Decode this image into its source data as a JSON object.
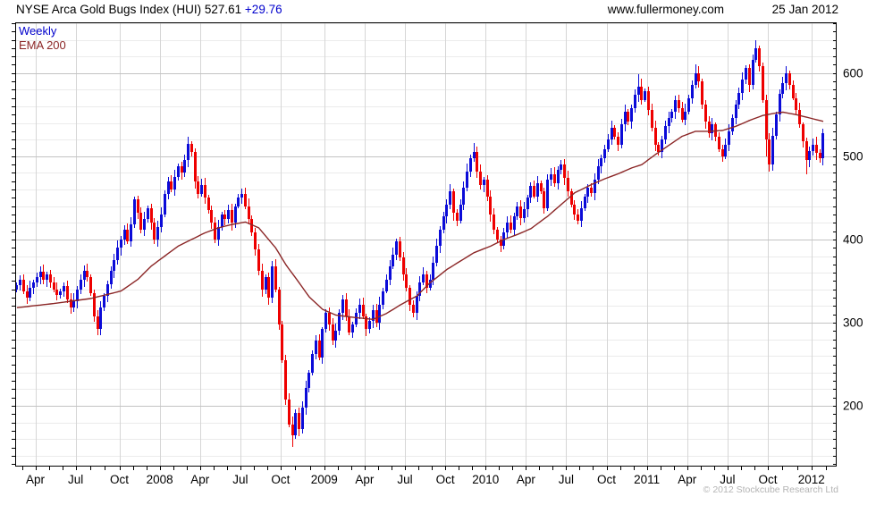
{
  "header": {
    "title": "NYSE Arca Gold Bugs Index (HUI)",
    "last_price": "527.61",
    "change": "+29.76",
    "url": "www.fullermoney.com",
    "date": "25 Jan 2012"
  },
  "legend": {
    "timeframe": "Weekly",
    "overlay": "EMA 200"
  },
  "footer": {
    "copyright": "© 2012 Stockcube Research Ltd"
  },
  "colors": {
    "up_candle": "#0b0bd8",
    "down_candle": "#ee0000",
    "ema_line": "#8b2626",
    "grid_major": "#c3c3c3",
    "grid_minor": "#ebebeb",
    "grid_vertical": "#d6d6d6",
    "axis": "#000000",
    "label_text": "#000000",
    "change_text": "#0000cc",
    "copyright_text": "#b4b4b4"
  },
  "chart_data": {
    "type": "candlestick",
    "title": "NYSE Arca Gold Bugs Index (HUI)",
    "timeframe": "Weekly",
    "last_close": 527.61,
    "weekly_change": 29.76,
    "first_open": 340,
    "closes": [
      345,
      352,
      338,
      330,
      342,
      348,
      355,
      361,
      352,
      358,
      348,
      340,
      333,
      338,
      344,
      328,
      318,
      326,
      340,
      352,
      362,
      355,
      335,
      308,
      292,
      318,
      332,
      346,
      362,
      375,
      390,
      400,
      412,
      398,
      418,
      448,
      432,
      412,
      425,
      438,
      420,
      400,
      415,
      430,
      455,
      470,
      460,
      475,
      488,
      480,
      495,
      515,
      505,
      470,
      455,
      465,
      450,
      435,
      420,
      400,
      415,
      430,
      425,
      435,
      420,
      440,
      450,
      455,
      440,
      425,
      408,
      388,
      362,
      340,
      355,
      330,
      368,
      340,
      298,
      255,
      208,
      178,
      165,
      192,
      172,
      198,
      222,
      240,
      262,
      278,
      258,
      292,
      312,
      298,
      278,
      290,
      312,
      328,
      308,
      288,
      298,
      312,
      322,
      308,
      292,
      302,
      315,
      300,
      322,
      338,
      352,
      368,
      382,
      398,
      378,
      358,
      342,
      322,
      312,
      332,
      348,
      358,
      342,
      352,
      372,
      392,
      412,
      428,
      442,
      458,
      432,
      422,
      442,
      462,
      482,
      498,
      505,
      482,
      465,
      472,
      452,
      430,
      412,
      400,
      392,
      408,
      420,
      412,
      428,
      440,
      426,
      436,
      450,
      464,
      452,
      468,
      458,
      438,
      472,
      478,
      468,
      484,
      490,
      474,
      458,
      442,
      430,
      422,
      438,
      452,
      462,
      456,
      472,
      488,
      498,
      508,
      520,
      534,
      524,
      514,
      538,
      554,
      542,
      558,
      574,
      584,
      568,
      578,
      556,
      534,
      514,
      505,
      520,
      536,
      546,
      554,
      568,
      558,
      544,
      554,
      570,
      586,
      600,
      590,
      562,
      542,
      528,
      538,
      524,
      508,
      500,
      514,
      530,
      546,
      562,
      576,
      592,
      606,
      586,
      616,
      630,
      608,
      568,
      520,
      490,
      525,
      550,
      575,
      588,
      600,
      586,
      570,
      556,
      538,
      518,
      495,
      506,
      514,
      504,
      497.85,
      527.61
    ],
    "wick_overrides": {
      "24": {
        "low": 285
      },
      "82": {
        "low": 151
      },
      "136": {
        "high": 516
      },
      "185": {
        "high": 599
      },
      "202": {
        "high": 610
      },
      "220": {
        "high": 640
      },
      "223": {
        "low": 500
      },
      "224": {
        "low": 482
      },
      "235": {
        "low": 478
      },
      "240": {
        "high": 533
      }
    },
    "ema200": {
      "label": "EMA 200",
      "anchors": [
        [
          0,
          318
        ],
        [
          11,
          323
        ],
        [
          22,
          329
        ],
        [
          31,
          338
        ],
        [
          36,
          352
        ],
        [
          40,
          368
        ],
        [
          44,
          380
        ],
        [
          48,
          392
        ],
        [
          52,
          400
        ],
        [
          56,
          408
        ],
        [
          60,
          414
        ],
        [
          64,
          418
        ],
        [
          68,
          421
        ],
        [
          72,
          414
        ],
        [
          77,
          390
        ],
        [
          80,
          370
        ],
        [
          84,
          348
        ],
        [
          87,
          331
        ],
        [
          91,
          316
        ],
        [
          95,
          309
        ],
        [
          101,
          306
        ],
        [
          106,
          304
        ],
        [
          110,
          311
        ],
        [
          114,
          321
        ],
        [
          119,
          332
        ],
        [
          123,
          348
        ],
        [
          128,
          364
        ],
        [
          132,
          374
        ],
        [
          136,
          384
        ],
        [
          141,
          392
        ],
        [
          145,
          400
        ],
        [
          149,
          406
        ],
        [
          153,
          413
        ],
        [
          158,
          428
        ],
        [
          162,
          442
        ],
        [
          166,
          456
        ],
        [
          171,
          466
        ],
        [
          175,
          473
        ],
        [
          179,
          479
        ],
        [
          183,
          486
        ],
        [
          186,
          490
        ],
        [
          190,
          502
        ],
        [
          194,
          513
        ],
        [
          198,
          524
        ],
        [
          202,
          530
        ],
        [
          206,
          530
        ],
        [
          210,
          531
        ],
        [
          214,
          536
        ],
        [
          218,
          543
        ],
        [
          222,
          549
        ],
        [
          226,
          552
        ],
        [
          228,
          553
        ],
        [
          232,
          550
        ],
        [
          236,
          546
        ],
        [
          240,
          542
        ]
      ]
    },
    "y_axis": {
      "side": "right",
      "labels": [
        600,
        500,
        400,
        300,
        200
      ],
      "label_step": 100,
      "minor_grid_step": 20,
      "minor_tick_step": 10,
      "value_range": [
        127,
        661
      ]
    },
    "x_axis": {
      "ticks": [
        {
          "label": "Apr",
          "week": 6
        },
        {
          "label": "Jul",
          "week": 18
        },
        {
          "label": "Oct",
          "week": 31
        },
        {
          "label": "2008",
          "week": 43
        },
        {
          "label": "Apr",
          "week": 55
        },
        {
          "label": "Jul",
          "week": 67
        },
        {
          "label": "Oct",
          "week": 79
        },
        {
          "label": "2009",
          "week": 92
        },
        {
          "label": "Apr",
          "week": 104
        },
        {
          "label": "Jul",
          "week": 116
        },
        {
          "label": "Oct",
          "week": 128
        },
        {
          "label": "2010",
          "week": 140
        },
        {
          "label": "Apr",
          "week": 152
        },
        {
          "label": "Jul",
          "week": 164
        },
        {
          "label": "Oct",
          "week": 176
        },
        {
          "label": "2011",
          "week": 188
        },
        {
          "label": "Apr",
          "week": 200
        },
        {
          "label": "Jul",
          "week": 212
        },
        {
          "label": "Oct",
          "week": 224
        },
        {
          "label": "2012",
          "week": 237
        }
      ]
    }
  }
}
